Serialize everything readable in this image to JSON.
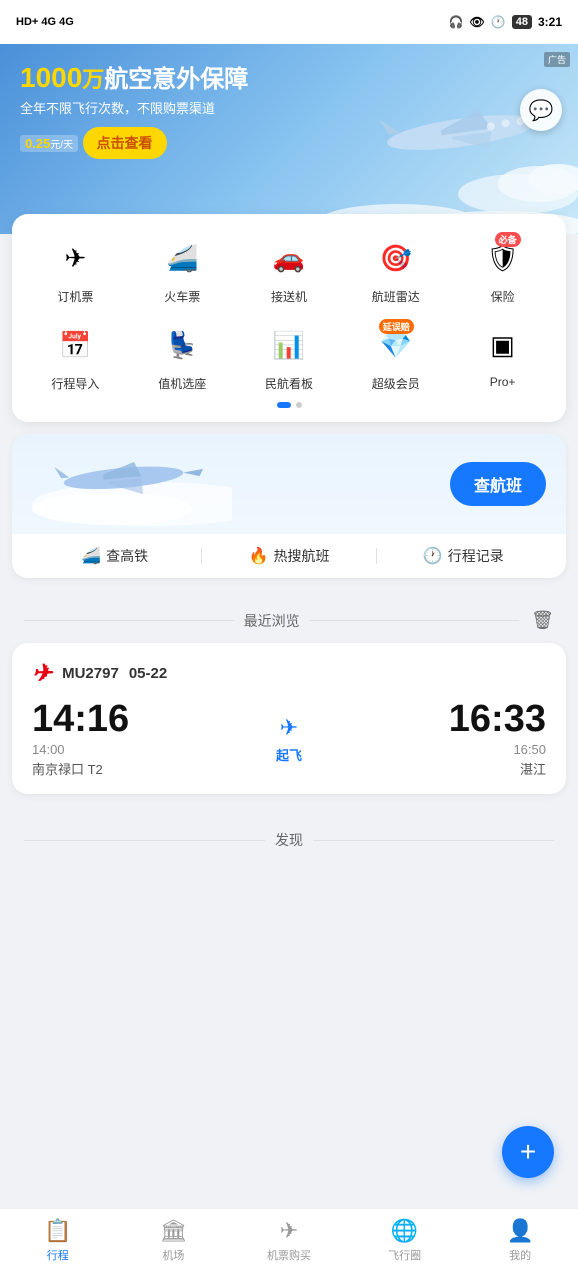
{
  "statusBar": {
    "left": "HD+ 4G 4G",
    "battery": "48",
    "time": "3:21"
  },
  "banner": {
    "amount": "1000",
    "unit": "万",
    "mainText": "航空意外保障",
    "subtitle": "全年不限飞行次数，不限购票渠道",
    "pricePrefix": "0.25",
    "priceUnit": "元/天",
    "btnLabel": "点击查看",
    "adLabel": "广告"
  },
  "chatBtn": "💬",
  "menuItems": [
    {
      "id": "book-flight",
      "icon": "✈",
      "label": "订机票",
      "badge": null
    },
    {
      "id": "train",
      "icon": "🚄",
      "label": "火车票",
      "badge": null
    },
    {
      "id": "transfer",
      "icon": "🚗",
      "label": "接送机",
      "badge": null
    },
    {
      "id": "radar",
      "icon": "🎯",
      "label": "航班雷达",
      "badge": null
    },
    {
      "id": "insurance",
      "icon": "🛡",
      "label": "保险",
      "badge": "必备"
    },
    {
      "id": "itinerary-import",
      "icon": "📅",
      "label": "行程导入",
      "badge": null
    },
    {
      "id": "checkin",
      "icon": "💺",
      "label": "值机选座",
      "badge": null
    },
    {
      "id": "aviation-board",
      "icon": "📈",
      "label": "民航看板",
      "badge": null
    },
    {
      "id": "super-member",
      "icon": "💎",
      "label": "超级会员",
      "badge": "延误赔"
    },
    {
      "id": "pro-plus",
      "icon": "⊞",
      "label": "Pro+",
      "badge": null
    }
  ],
  "flightSearch": {
    "searchBtnLabel": "查航班"
  },
  "quickLinks": [
    {
      "id": "train-query",
      "icon": "🚄",
      "label": "查高铁"
    },
    {
      "id": "hot-flight",
      "icon": "🔥",
      "label": "热搜航班"
    },
    {
      "id": "trip-record",
      "icon": "🕐",
      "label": "行程记录"
    }
  ],
  "recentBrowse": {
    "title": "最近浏览",
    "clearIcon": "🗑"
  },
  "flightRecord": {
    "airlineLogo": "CE",
    "flightNumber": "MU2797",
    "date": "05-22",
    "departTime": "14:16",
    "departScheduled": "14:00",
    "departAirport": "南京禄口 T2",
    "arriveTime": "16:33",
    "arriveScheduled": "16:50",
    "arriveAirport": "湛江",
    "status": "起飞"
  },
  "discover": {
    "title": "发现"
  },
  "bottomNav": [
    {
      "id": "itinerary",
      "icon": "📋",
      "label": "行程",
      "active": true
    },
    {
      "id": "airport",
      "icon": "🏢",
      "label": "机场",
      "active": false
    },
    {
      "id": "buy-ticket",
      "icon": "✈",
      "label": "机票购买",
      "active": false
    },
    {
      "id": "flight-circle",
      "icon": "🌐",
      "label": "飞行圈",
      "active": false
    },
    {
      "id": "mine",
      "icon": "👤",
      "label": "我的",
      "active": false
    }
  ],
  "fab": "+"
}
